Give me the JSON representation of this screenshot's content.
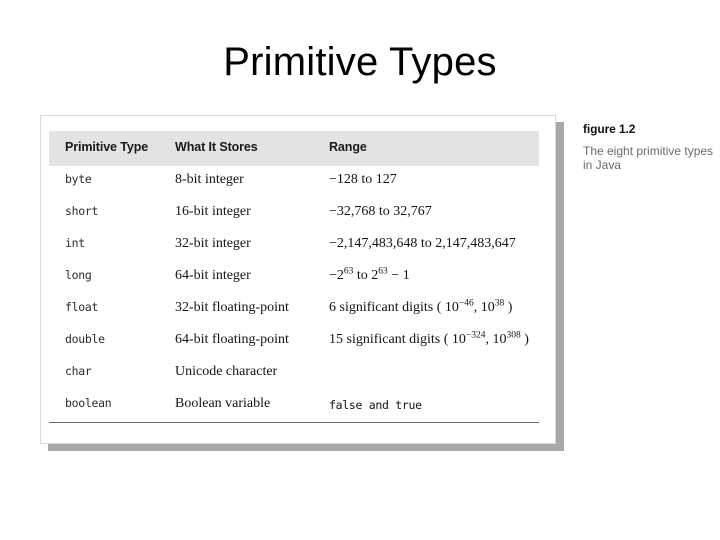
{
  "slide": {
    "title": "Primitive Types"
  },
  "figure": {
    "caption_label": "figure 1.2",
    "caption_text": "The eight primitive types in Java",
    "table": {
      "headers": [
        "Primitive Type",
        "What It Stores",
        "Range"
      ],
      "rows": [
        {
          "type": "byte",
          "stores": "8-bit integer",
          "range_text": "−128 to 127",
          "range_html": "−128 to 127",
          "range_mono": false
        },
        {
          "type": "short",
          "stores": "16-bit integer",
          "range_text": "−32,768 to 32,767",
          "range_html": "−32,768 to 32,767",
          "range_mono": false
        },
        {
          "type": "int",
          "stores": "32-bit integer",
          "range_text": "−2,147,483,648 to 2,147,483,647",
          "range_html": "−2,147,483,648 to 2,147,483,647",
          "range_mono": false
        },
        {
          "type": "long",
          "stores": "64-bit integer",
          "range_text": "−2^63 to 2^63 − 1",
          "range_html": "−2<sup>63</sup> to 2<sup>63</sup> − 1",
          "range_mono": false
        },
        {
          "type": "float",
          "stores": "32-bit floating-point",
          "range_text": "6 significant digits ( 10^−46, 10^38 )",
          "range_html": "6 significant digits ( 10<sup>−46</sup>, 10<sup>38</sup> )",
          "range_mono": false
        },
        {
          "type": "double",
          "stores": "64-bit floating-point",
          "range_text": "15 significant digits ( 10^−324, 10^308 )",
          "range_html": "15 significant digits ( 10<sup>−324</sup>, 10<sup>308</sup> )",
          "range_mono": false
        },
        {
          "type": "char",
          "stores": "Unicode character",
          "range_text": "",
          "range_html": "",
          "range_mono": false
        },
        {
          "type": "boolean",
          "stores": "Boolean variable",
          "range_text": "false and true",
          "range_html": "false and true",
          "range_mono": true
        }
      ]
    }
  },
  "colors": {
    "header_band": "#e3e3e3",
    "page_background": "#ffffff",
    "shadow": "#a8a8a8",
    "caption_label": "#111111",
    "caption_text": "#6a6a6a",
    "rule": "#6d6d6d",
    "slide_background": "#ffffff",
    "text": "#1c1c1c"
  }
}
